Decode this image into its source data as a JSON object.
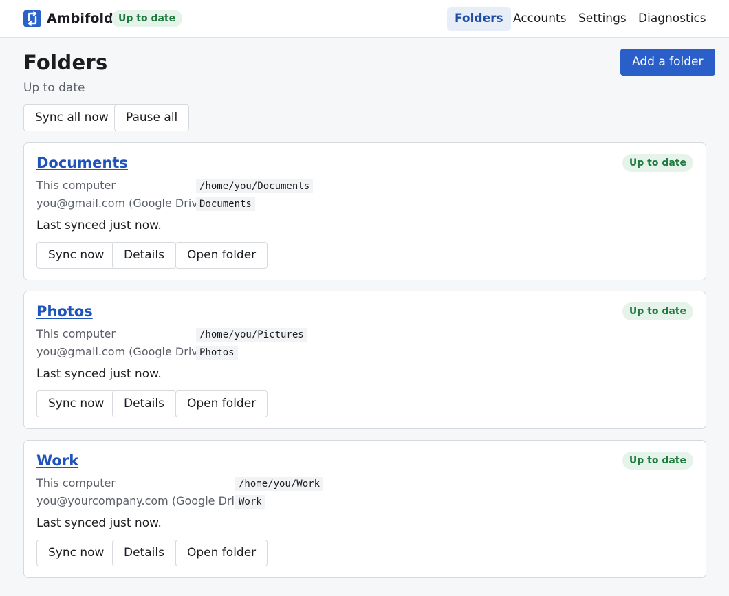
{
  "app": {
    "name": "Ambifold",
    "status": "Up to date",
    "accent": "#2a5fc9"
  },
  "nav": {
    "items": [
      "Folders",
      "Accounts",
      "Settings",
      "Diagnostics"
    ],
    "active": "Folders"
  },
  "page": {
    "title": "Folders",
    "status": "Up to date",
    "add_button": "Add a folder",
    "sync_all": "Sync all now",
    "pause_all": "Pause all"
  },
  "folders": [
    {
      "name": "Documents",
      "status": "Up to date",
      "local_label": "This computer",
      "local_path": "/home/you/Documents",
      "remote_label": "you@gmail.com (Google Drive)",
      "remote_path": "Documents",
      "last_synced": "Last synced just now.",
      "actions": [
        "Sync now",
        "Details",
        "Open folder"
      ]
    },
    {
      "name": "Photos",
      "status": "Up to date",
      "local_label": "This computer",
      "local_path": "/home/you/Pictures",
      "remote_label": "you@gmail.com (Google Drive)",
      "remote_path": "Photos",
      "last_synced": "Last synced just now.",
      "actions": [
        "Sync now",
        "Details",
        "Open folder"
      ]
    },
    {
      "name": "Work",
      "status": "Up to date",
      "local_label": "This computer",
      "local_path": "/home/you/Work",
      "remote_label": "you@yourcompany.com (Google Drive)",
      "remote_path": "Work",
      "last_synced": "Last synced just now.",
      "actions": [
        "Sync now",
        "Details",
        "Open folder"
      ]
    }
  ],
  "colors": {
    "status_bg": "#e6f3ea",
    "status_fg": "#1f7a3e",
    "link": "#1f54bc",
    "nav_active_bg": "#e8eef8"
  },
  "icons": {
    "logo": "sync-arrows-icon"
  }
}
